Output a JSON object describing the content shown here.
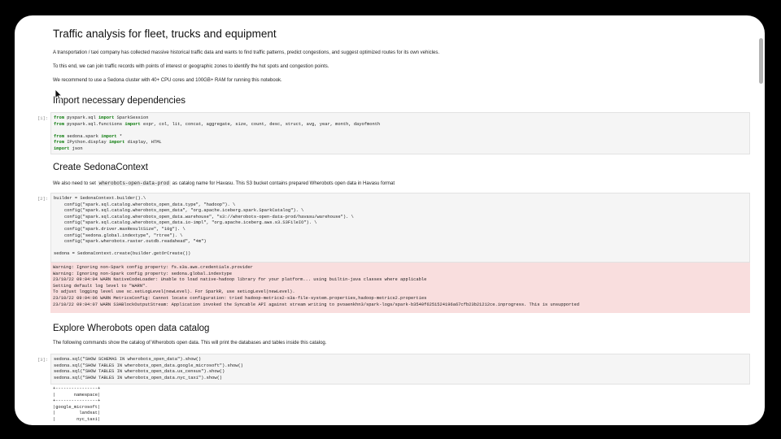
{
  "notebook": {
    "title": "Traffic analysis for fleet, trucks and equipment",
    "intro": [
      "A transportation / taxi company has collected massive historical traffic data and wants to find traffic patterns, predict congestions, and suggest optimized routes for its own vehicles.",
      "To this end, we can join traffic records with points of interest or geographic zones to identify the hot spots and congestion points.",
      "We recommend to use a Sedona cluster with 40+ CPU cores and 100GB+ RAM for running this notebook."
    ],
    "section1": {
      "heading": "Import necessary dependencies",
      "prompt": "[1]:",
      "lines": [
        "from pyspark.sql import SparkSession",
        "from pyspark.sql.functions import expr, col, lit, concat, aggregate, size, count, desc, struct, avg, year, month, dayofmonth",
        "",
        "from sedona.spark import *",
        "from IPython.display import display, HTML",
        "import json"
      ]
    },
    "section2": {
      "heading": "Create SedonaContext",
      "para_before": "We also need to set",
      "para_code": "wherobots-open-data-prod",
      "para_after": "as catalog name for Havasu. This S3 bucket contains prepared Wherobots open data in Havasu format",
      "prompt": "[2]:",
      "lines": [
        "builder = SedonaContext.builder().\\",
        "    config(\"spark.sql.catalog.wherobots_open_data.type\", \"hadoop\"). \\",
        "    config(\"spark.sql.catalog.wherobots_open_data\", \"org.apache.iceberg.spark.SparkCatalog\"). \\",
        "    config(\"spark.sql.catalog.wherobots_open_data.warehouse\", \"s3://wherobots-open-data-prod/havasu/warehouse\"). \\",
        "    config(\"spark.sql.catalog.wherobots_open_data.io-impl\", \"org.apache.iceberg.aws.s3.S3FileIO\"). \\",
        "    config(\"spark.driver.maxResultSize\", \"10g\"). \\",
        "    config(\"sedona.global.indextype\", \"rtree\"). \\",
        "    config(\"spark.wherobots.raster.outdb.readahead\", \"4m\")",
        "",
        "sedona = SedonaContext.create(builder.getOrCreate())"
      ],
      "stderr": [
        "Warning: Ignoring non-Spark config property: fs.s3a.aws.credentials.provider",
        "Warning: Ignoring non-Spark config property: sedona.global.indextype",
        "23/10/22 09:04:04 WARN NativeCodeLoader: Unable to load native-hadoop library for your platform... using builtin-java classes where applicable",
        "Setting default log level to \"WARN\".",
        "To adjust logging level use sc.setLogLevel(newLevel). For SparkR, use setLogLevel(newLevel).",
        "23/10/22 09:04:06 WARN MetricsConfig: Cannot locate configuration: tried hadoop-metrics2-s3a-file-system.properties,hadoop-metrics2.properties",
        "23/10/22 09:04:07 WARN S3ABlockOutputStream: Application invoked the Syncable API against stream writing to pvoaenkhn3/spark-logs/spark-b3540f6251524196a67cfb23b21212ce.inprogress. This is unsupported"
      ]
    },
    "section3": {
      "heading": "Explore Wherobots open data catalog",
      "para": "The following commands show the catalog of Wherobots open data. This will print the databases and tables inside this catalog.",
      "prompt": "[3]:",
      "lines": [
        "sedona.sql(\"SHOW SCHEMAS IN wherobots_open_data\").show()",
        "sedona.sql(\"SHOW TABLES IN wherobots_open_data.google_microsoft\").show()",
        "sedona.sql(\"SHOW TABLES IN wherobots_open_data.us_census\").show()",
        "sedona.sql(\"SHOW TABLES IN wherobots_open_data.nyc_taxi\").show()"
      ],
      "output": [
        "+----------------+",
        "|       namespace|",
        "+----------------+",
        "|google_microsoft|",
        "|         landsat|",
        "|        nyc_taxi|"
      ]
    }
  }
}
